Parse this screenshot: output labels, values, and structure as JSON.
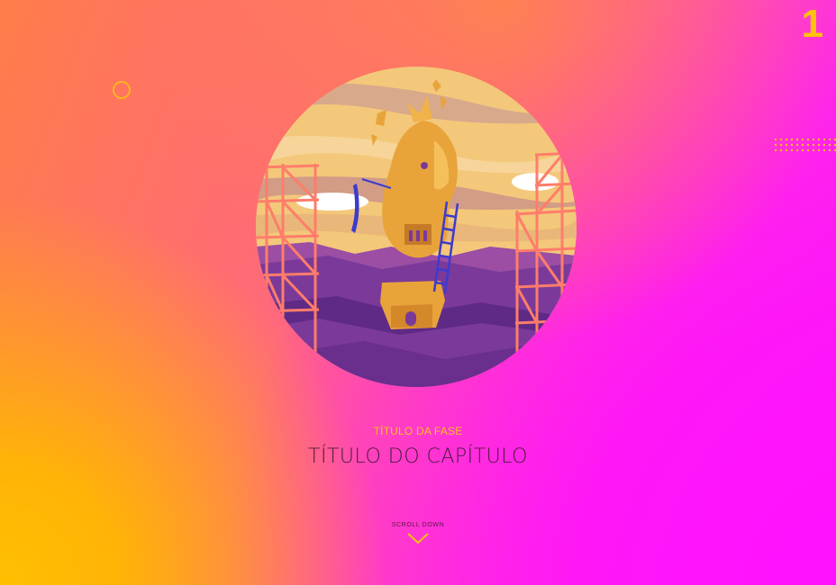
{
  "page_number": "1",
  "phase_title": "TÍTULO DA FASE",
  "chapter_title": "TÍTULO DO CAPÍTULO",
  "scroll": {
    "label": "SCROLL DOWN",
    "icon": "chevron-down-icon"
  },
  "decorations": {
    "ring": "ring-icon",
    "dots": "dot-grid",
    "illustration": "trojan-horse-illustration"
  },
  "colors": {
    "accent": "#ffc20e",
    "gradient_start": "#ffc000",
    "gradient_end": "#ff14ff",
    "title_text": "#4a1a3a"
  }
}
